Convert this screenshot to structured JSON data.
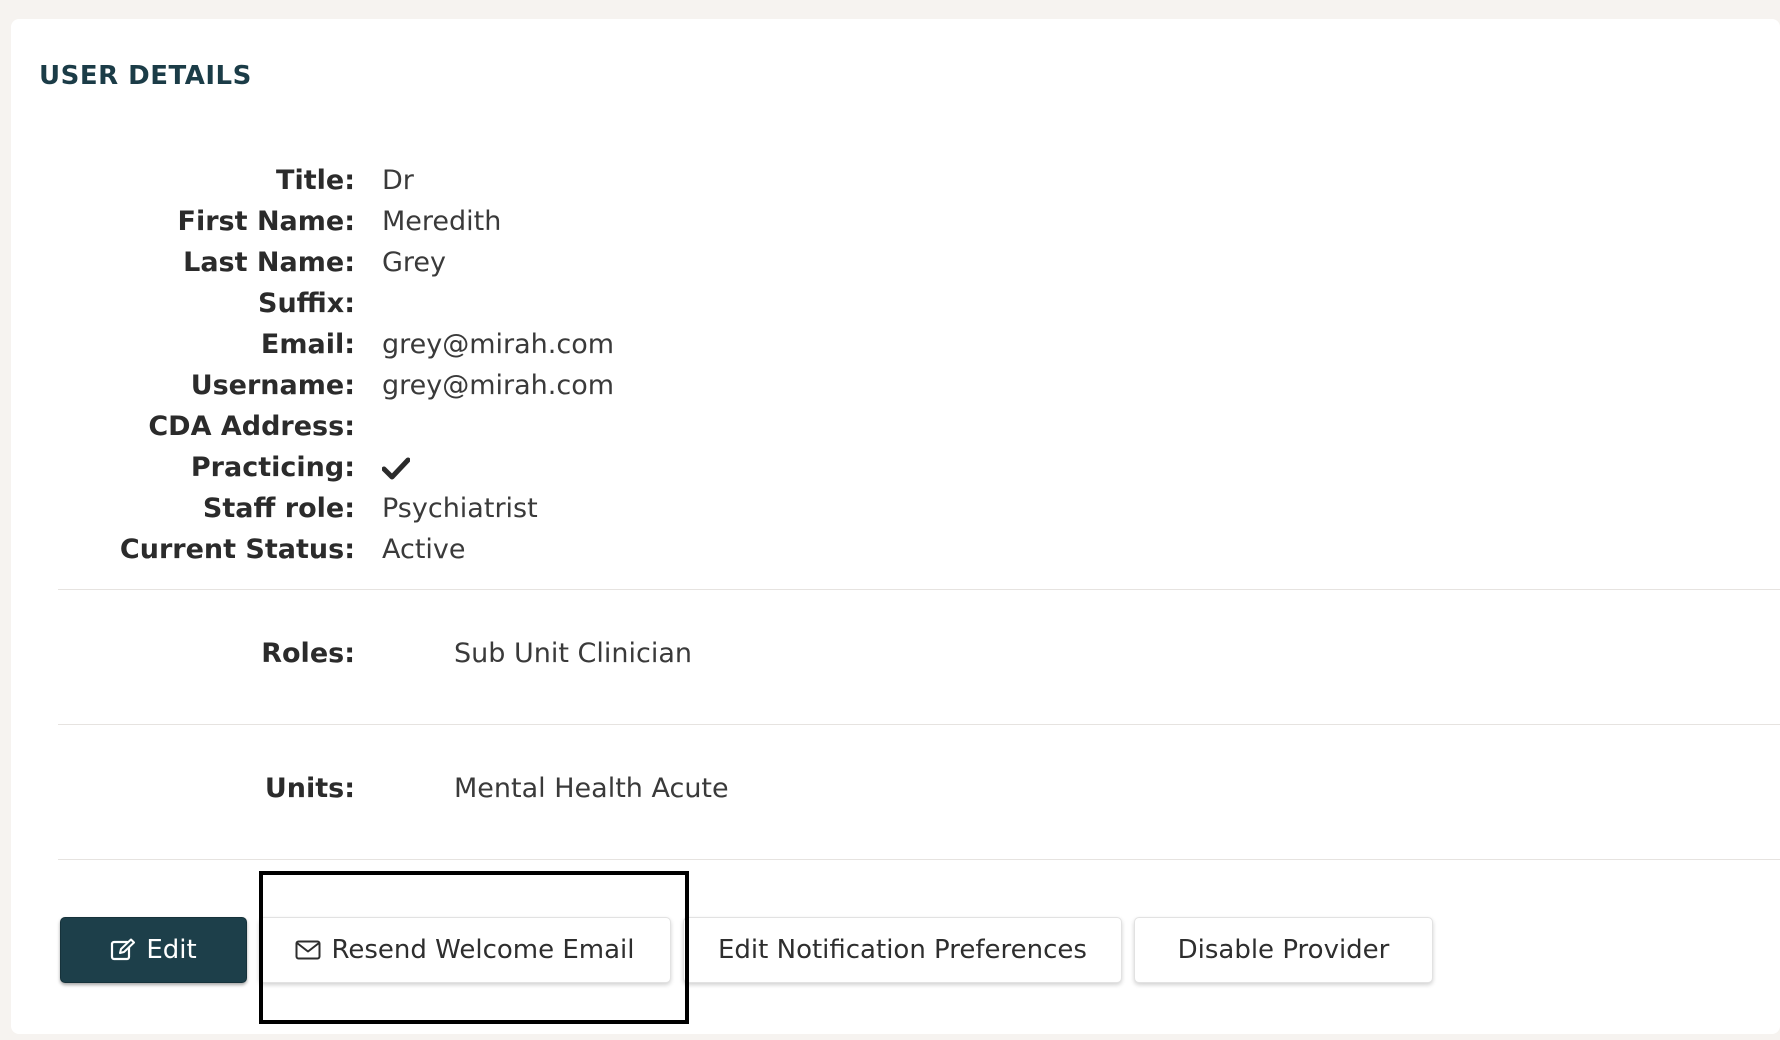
{
  "section": {
    "title": "USER DETAILS"
  },
  "details": [
    {
      "label": "Title:",
      "value": "Dr"
    },
    {
      "label": "First Name:",
      "value": "Meredith"
    },
    {
      "label": "Last Name:",
      "value": "Grey"
    },
    {
      "label": "Suffix:",
      "value": ""
    },
    {
      "label": "Email:",
      "value": "grey@mirah.com"
    },
    {
      "label": "Username:",
      "value": "grey@mirah.com"
    },
    {
      "label": "CDA Address:",
      "value": ""
    },
    {
      "label": "Practicing:",
      "value": "",
      "icon": "checkmark-icon"
    },
    {
      "label": "Staff role:",
      "value": "Psychiatrist"
    },
    {
      "label": "Current Status:",
      "value": "Active"
    }
  ],
  "roles": {
    "label": "Roles:",
    "value": "Sub Unit Clinician"
  },
  "units": {
    "label": "Units:",
    "value": "Mental Health Acute"
  },
  "actions": {
    "edit": {
      "label": "Edit",
      "icon": "edit-icon"
    },
    "resend_welcome": {
      "label": "Resend Welcome Email",
      "icon": "envelope-icon"
    },
    "notification_prefs": {
      "label": "Edit Notification Preferences"
    },
    "disable_provider": {
      "label": "Disable Provider"
    }
  },
  "colors": {
    "page_background": "#f6f3f0",
    "card_background": "#ffffff",
    "title_color": "#1b3c47",
    "primary_button": "#1d3f4a",
    "highlight_border": "#000000"
  }
}
